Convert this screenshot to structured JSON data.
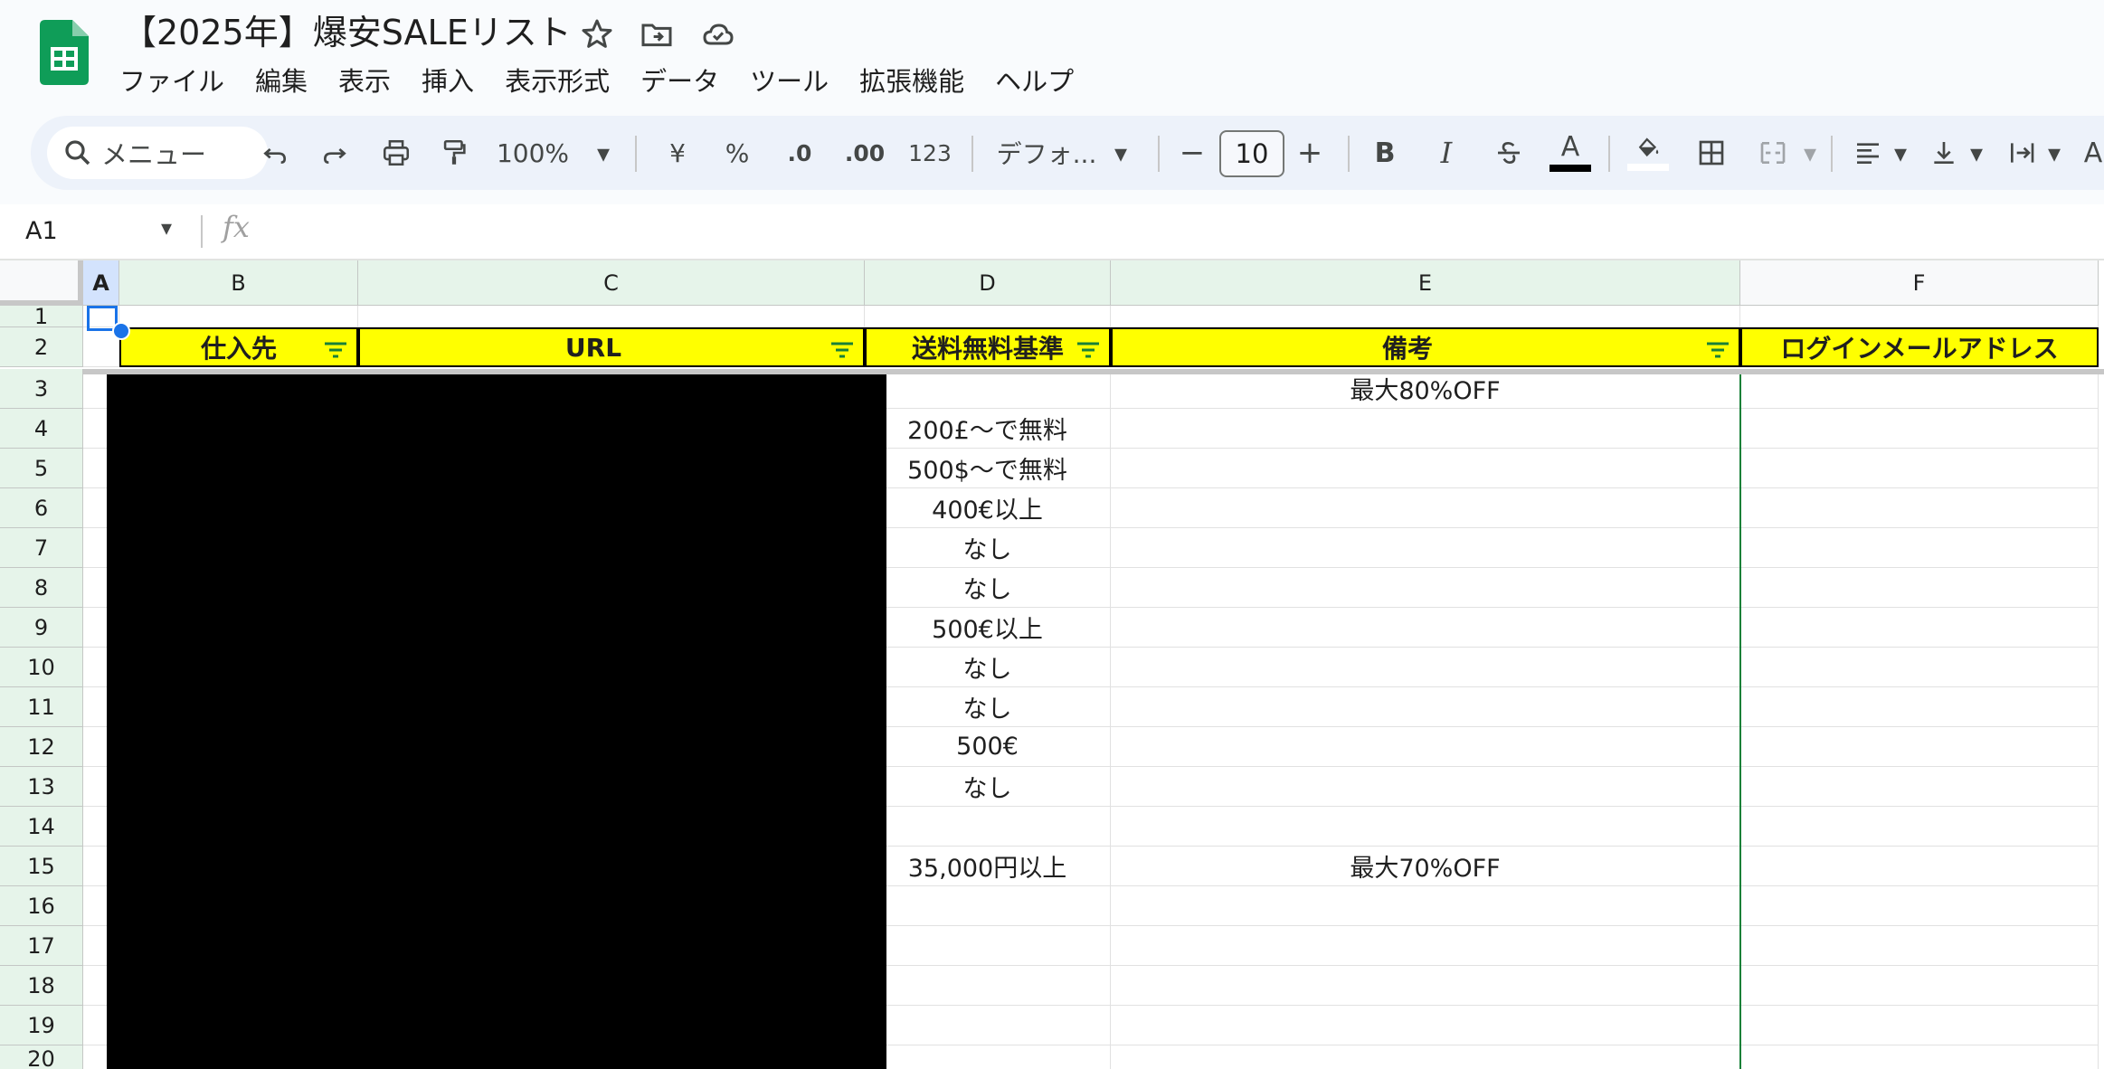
{
  "doc": {
    "title": "【2025年】爆安SALEリスト"
  },
  "menu": [
    "ファイル",
    "編集",
    "表示",
    "挿入",
    "表示形式",
    "データ",
    "ツール",
    "拡張機能",
    "ヘルプ"
  ],
  "toolbar": {
    "search_label": "メニュー",
    "zoom": "100%",
    "currency": "¥",
    "percent": "%",
    "dec_decrease": ".0",
    "dec_increase": ".00",
    "number_format": "123",
    "font": "デフォ...",
    "font_size": "10",
    "bold": "B",
    "italic": "I",
    "text_color_letter": "A",
    "overflow_letter": "A"
  },
  "formula_bar": {
    "cell_ref": "A1",
    "fx": "fx"
  },
  "columns": [
    "A",
    "B",
    "C",
    "D",
    "E",
    "F"
  ],
  "rows": [
    "1",
    "2",
    "3",
    "4",
    "5",
    "6",
    "7",
    "8",
    "9",
    "10",
    "11",
    "12",
    "13",
    "14",
    "15",
    "16",
    "17",
    "18",
    "19",
    "20"
  ],
  "header_row": {
    "B": "仕入先",
    "C": "URL",
    "D": "送料無料基準",
    "E": "備考",
    "F": "ログインメールアドレス"
  },
  "col_D": [
    "",
    "200£〜で無料",
    "500$〜で無料",
    "400€以上",
    "なし",
    "なし",
    "500€以上",
    "なし",
    "なし",
    "500€",
    "なし",
    "",
    "35,000円以上",
    "",
    "",
    "",
    ""
  ],
  "col_E": [
    "最大80%OFF",
    "",
    "",
    "",
    "",
    "",
    "",
    "",
    "",
    "",
    "",
    "",
    "最大70%OFF",
    "",
    "",
    "",
    ""
  ],
  "colors": {
    "header_yellow": "#ffff00",
    "header_green": "#e6f4ea",
    "selection_blue": "#1a73e8",
    "redaction": "#000000"
  }
}
